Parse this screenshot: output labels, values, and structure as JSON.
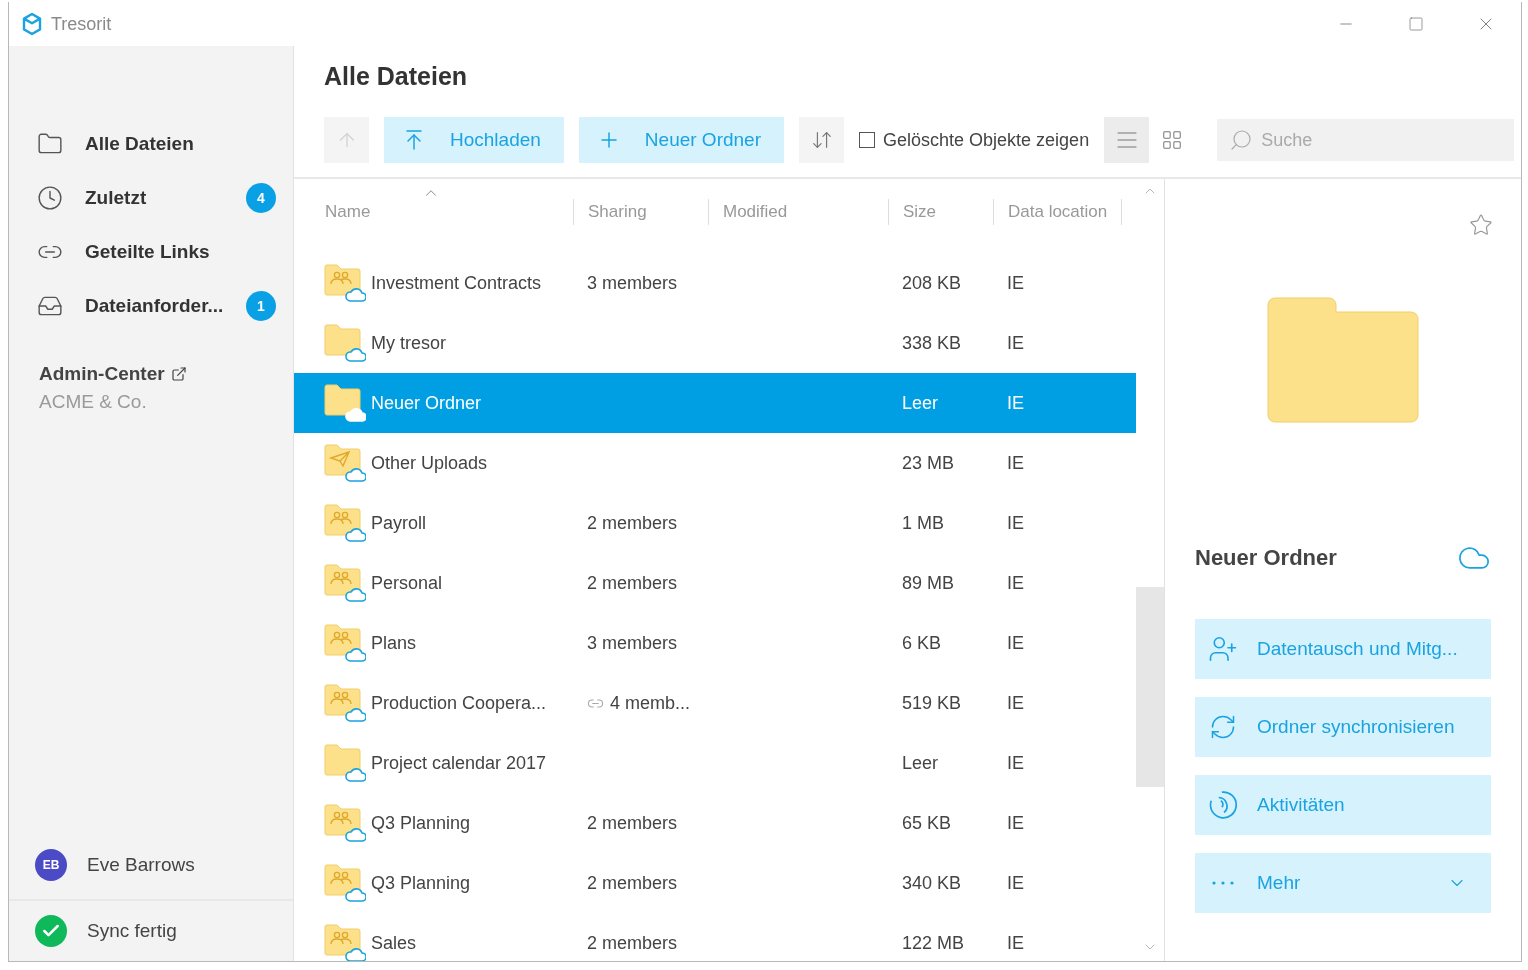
{
  "window": {
    "title": "Tresorit"
  },
  "sidebar": {
    "items": [
      {
        "kind": "folder",
        "label": "Alle Dateien"
      },
      {
        "kind": "recent",
        "label": "Zuletzt",
        "badge": "4"
      },
      {
        "kind": "links",
        "label": "Geteilte Links"
      },
      {
        "kind": "requests",
        "label": "Dateianforder...",
        "badge": "1"
      }
    ],
    "admin": {
      "label": "Admin-Center",
      "company": "ACME & Co."
    },
    "user": {
      "initials": "EB",
      "name": "Eve Barrows"
    },
    "status": "Sync fertig"
  },
  "main": {
    "title": "Alle Dateien",
    "toolbar": {
      "up_disabled": true,
      "upload": "Hochladen",
      "new_folder": "Neuer Ordner",
      "show_deleted": {
        "label": "Gelöschte Objekte zeigen",
        "checked": false
      },
      "views": [
        {
          "kind": "list",
          "selected": true
        },
        {
          "kind": "grid",
          "selected": false
        }
      ],
      "search": {
        "placeholder": "Suche"
      }
    },
    "table": {
      "columns": [
        {
          "label": "Name",
          "sorted": true
        },
        {
          "label": "Sharing",
          "sorted": false
        },
        {
          "label": "Modified",
          "sorted": false
        },
        {
          "label": "Size",
          "sorted": false
        },
        {
          "label": "Data location",
          "sorted": false
        }
      ],
      "rows": [
        {
          "kind": "shared",
          "name": "Investment Contracts",
          "sharing": "3 members",
          "linked": false,
          "size": "208 KB",
          "location": "IE",
          "selected": false
        },
        {
          "kind": "plain",
          "name": "My tresor",
          "linked": false,
          "size": "338 KB",
          "location": "IE",
          "selected": false
        },
        {
          "kind": "plain",
          "name": "Neuer Ordner",
          "linked": false,
          "size": "Leer",
          "location": "IE",
          "selected": true
        },
        {
          "kind": "upload",
          "name": "Other Uploads",
          "linked": false,
          "size": "23 MB",
          "location": "IE",
          "selected": false
        },
        {
          "kind": "shared",
          "name": "Payroll",
          "sharing": "2 members",
          "linked": false,
          "size": "1 MB",
          "location": "IE",
          "selected": false
        },
        {
          "kind": "shared",
          "name": "Personal",
          "sharing": "2 members",
          "linked": false,
          "size": "89 MB",
          "location": "IE",
          "selected": false
        },
        {
          "kind": "shared",
          "name": "Plans",
          "sharing": "3 members",
          "linked": false,
          "size": "6 KB",
          "location": "IE",
          "selected": false
        },
        {
          "kind": "shared",
          "name": "Production Coopera...",
          "sharing": "4 memb...",
          "linked": true,
          "size": "519 KB",
          "location": "IE",
          "selected": false
        },
        {
          "kind": "plain",
          "name": "Project calendar 2017",
          "linked": false,
          "size": "Leer",
          "location": "IE",
          "selected": false
        },
        {
          "kind": "shared",
          "name": "Q3 Planning",
          "sharing": "2 members",
          "linked": false,
          "size": "65 KB",
          "location": "IE",
          "selected": false
        },
        {
          "kind": "shared",
          "name": "Q3 Planning",
          "sharing": "2 members",
          "linked": false,
          "size": "340 KB",
          "location": "IE",
          "selected": false
        },
        {
          "kind": "shared",
          "name": "Sales",
          "sharing": "2 members",
          "linked": false,
          "size": "122 MB",
          "location": "IE",
          "selected": false
        }
      ]
    }
  },
  "details": {
    "title": "Neuer Ordner",
    "actions": [
      {
        "kind": "share",
        "label": "Datentausch und Mitg..."
      },
      {
        "kind": "sync",
        "label": "Ordner synchronisieren"
      },
      {
        "kind": "activity",
        "label": "Aktivitäten"
      },
      {
        "kind": "more",
        "label": "Mehr"
      }
    ]
  }
}
